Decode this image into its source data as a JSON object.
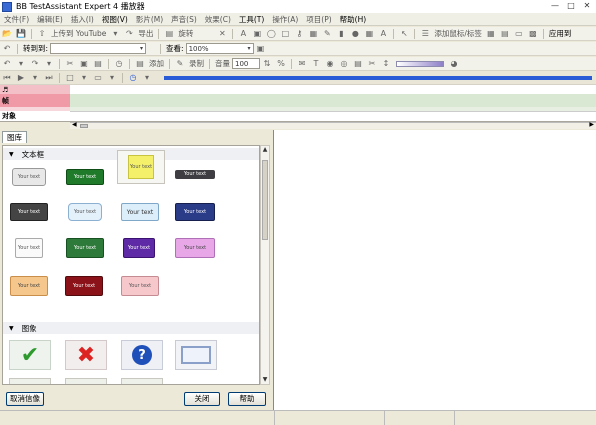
{
  "window": {
    "title": "BB TestAssistant Expert 4 播放器"
  },
  "menu": [
    "文件(F)",
    "编辑(E)",
    "插入(I)",
    "视图(V)",
    "影片(M)",
    "声音(S)",
    "效果(C)",
    "工具(T)",
    "操作(A)",
    "项目(P)",
    "帮助(H)"
  ],
  "toolbar1": {
    "upload_label": "上传到 YouTube",
    "export_label": "导出",
    "rotate_label": "旋转",
    "add_mouse_label": "添加鼠标/标签",
    "apply_label": "应用到"
  },
  "toolbar2": {
    "goto_label": "转到到:",
    "goto_value": "",
    "view_label": "查看:",
    "zoom_value": "100%"
  },
  "toolbar3": {
    "add_label": "添加",
    "record_label": "录制",
    "volume_label": "音量",
    "volume_value": "100"
  },
  "timeline": {
    "row_frame": "帧",
    "row_object": "对象"
  },
  "panel": {
    "tab_label": "图库",
    "section_textbox": "文本框",
    "section_image": "图象",
    "item_text": "Your text",
    "cancel_image_label": "取消信像",
    "close_label": "关闭",
    "help_label": "帮助"
  },
  "colors": {
    "accent_blue": "#2a5bd7",
    "timeline_pink": "#ef9aa6",
    "timeline_green": "#d9e8d3"
  },
  "icons": [
    "app-icon",
    "minimize-icon",
    "maximize-icon",
    "close-icon",
    "open-icon",
    "save-icon",
    "upload-icon",
    "undo-icon",
    "redo-icon",
    "play-icon",
    "stop-icon",
    "clock-icon",
    "check-icon",
    "cross-icon",
    "question-icon"
  ]
}
